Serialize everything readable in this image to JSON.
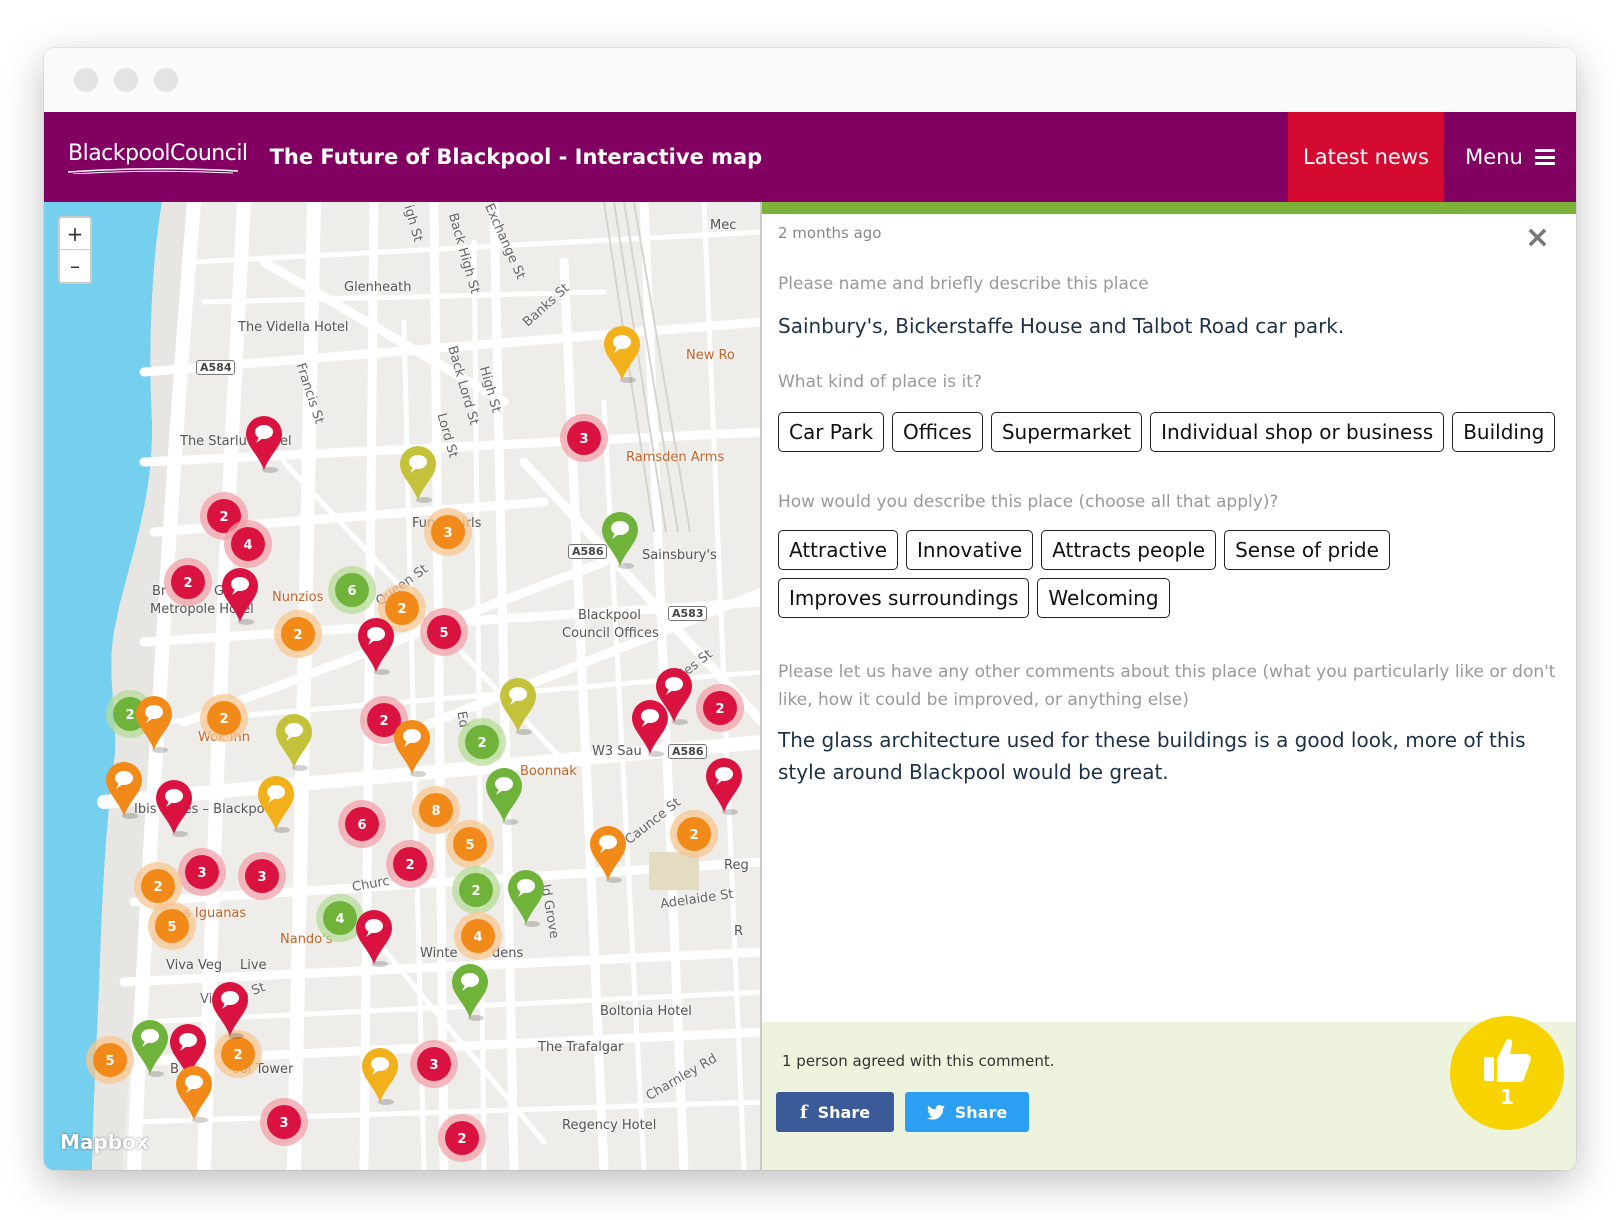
{
  "window": {
    "controls": [
      "close",
      "minimize",
      "maximize"
    ]
  },
  "header": {
    "logo": "BlackpoolCouncil",
    "title": "The Future of Blackpool - Interactive map",
    "nav": {
      "latest_news": "Latest news",
      "menu": "Menu"
    },
    "colors": {
      "brand": "#820062",
      "news": "#d4092f"
    }
  },
  "map": {
    "zoom_in": "+",
    "zoom_out": "–",
    "attribution": "Mapbox",
    "labels": {
      "glenheath": "Glenheath",
      "vidella": "The Vidella Hotel",
      "starlight": "The Starlu",
      "starlight2": "el",
      "metropole1": "Br",
      "metropole1b": "Gr",
      "metropole2": "Metropole Hotel",
      "nunzios": "Nunzios",
      "funny_girls": "Fun",
      "funny_girls2": "irls",
      "ramsden": "Ramsden Arms",
      "sainsburys": "Sainsbury's",
      "council1": "Blackpool",
      "council2": "Council Offices",
      "wok_inn": "Wok Inn",
      "ibis": "Ibis S",
      "ibis2": "les – Blackpool",
      "w3": "W3 Sau",
      "boonnak": "Boonnak",
      "iguanas": "s Iguanas",
      "nandos": "Nando's",
      "winter": "Winte",
      "winter2": "dens",
      "viva": "Viva Veg",
      "viva2": "Live",
      "boltonia": "Boltonia Hotel",
      "trafalgar": "The Trafalgar",
      "regency": "Regency Hotel",
      "tower": "B",
      "tower2": "ool Tower",
      "new_ro": "New Ro",
      "reg": "Reg",
      "r": "R",
      "mec": "Mec"
    },
    "roads": {
      "high_st": "igh St",
      "back_high": "Back High St",
      "exchange": "Exchange St",
      "banks": "Banks St",
      "francis": "Francis St",
      "back_lord": "Back Lord St",
      "high_st2": "High St",
      "lord": "Lord St",
      "queen": "Queen St",
      "charles": "rles St",
      "caunce": "Caunce St",
      "church": "Churc",
      "adelaide": "Adelaide St",
      "victoria": "Vic",
      "victoria2": "a St",
      "grove": "ld Grove",
      "charnley": "Charnley Rd",
      "ed": "Ed"
    },
    "shields": {
      "a584": "A584",
      "a586": "A586",
      "a583": "A583",
      "a586b": "A586"
    },
    "marker_colors": {
      "red": "#d9123f",
      "orange": "#f28a1a",
      "yellow": "#f2b11b",
      "olive": "#c4c23a",
      "green": "#6fb33a"
    },
    "clusters": [
      {
        "n": "3"
      },
      {
        "n": "2"
      },
      {
        "n": "4"
      },
      {
        "n": "2"
      },
      {
        "n": "6"
      },
      {
        "n": "2"
      },
      {
        "n": "5"
      },
      {
        "n": "3"
      },
      {
        "n": "2"
      },
      {
        "n": "2"
      },
      {
        "n": "2"
      },
      {
        "n": "2"
      },
      {
        "n": "2"
      },
      {
        "n": "6"
      },
      {
        "n": "8"
      },
      {
        "n": "5"
      },
      {
        "n": "3"
      },
      {
        "n": "3"
      },
      {
        "n": "2"
      },
      {
        "n": "2"
      },
      {
        "n": "2"
      },
      {
        "n": "5"
      },
      {
        "n": "4"
      },
      {
        "n": "4"
      },
      {
        "n": "5"
      },
      {
        "n": "2"
      },
      {
        "n": "3"
      },
      {
        "n": "2"
      },
      {
        "n": "2"
      },
      {
        "n": "3"
      },
      {
        "n": "2"
      }
    ]
  },
  "panel": {
    "accent": "#7bb33a",
    "timestamp": "2 months ago",
    "close_icon": "×",
    "q1": "Please name and briefly describe this place",
    "a1": "Sainbury's, Bickerstaffe House and Talbot Road car park.",
    "q2": "What kind of place is it?",
    "kind_tags": [
      "Car Park",
      "Offices",
      "Supermarket",
      "Individual shop or business",
      "Building"
    ],
    "q3": "How would you describe this place (choose all that apply)?",
    "describe_tags": [
      "Attractive",
      "Innovative",
      "Attracts people",
      "Sense of pride",
      "Improves surroundings",
      "Welcoming"
    ],
    "q4": "Please let us have any other comments about this place (what you particularly like or don't like, how it could be improved, or anything else)",
    "comment": "The glass architecture used for these buildings is a good look, more of this style around Blackpool would be great.",
    "agree_text": "1 person agreed with this comment.",
    "share_fb": "Share",
    "share_tw": "Share",
    "like_count": "1"
  }
}
